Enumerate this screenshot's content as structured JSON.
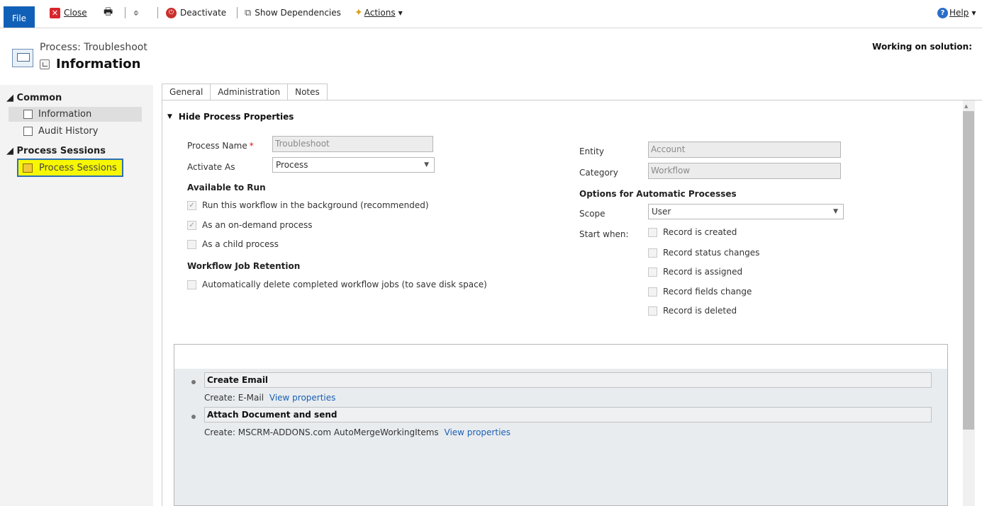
{
  "ribbon": {
    "file_label": "File",
    "close_label": "Close",
    "deactivate_label": "Deactivate",
    "show_dependencies_label": "Show Dependencies",
    "actions_label": "Actions",
    "help_label": "Help"
  },
  "header": {
    "subtitle": "Process: Troubleshoot",
    "title": "Information",
    "solution": "Working on solution:"
  },
  "nav": {
    "common_header": "Common",
    "items": [
      {
        "label": "Information",
        "icon": "process-icon"
      },
      {
        "label": "Audit History",
        "icon": "audit-icon"
      }
    ],
    "sessions_header": "Process Sessions",
    "sessions_item": "Process Sessions"
  },
  "tabs": [
    "General",
    "Administration",
    "Notes"
  ],
  "form": {
    "section_title": "Hide Process Properties",
    "process_name_label": "Process Name",
    "process_name_value": "Troubleshoot",
    "activate_as_label": "Activate As",
    "activate_as_value": "Process",
    "available_to_run": "Available to Run",
    "run_background": "Run this workflow in the background (recommended)",
    "on_demand": "As an on-demand process",
    "child_process": "As a child process",
    "job_retention": "Workflow Job Retention",
    "auto_delete": "Automatically delete completed workflow jobs (to save disk space)",
    "entity_label": "Entity",
    "entity_value": "Account",
    "category_label": "Category",
    "category_value": "Workflow",
    "options_header": "Options for Automatic Processes",
    "scope_label": "Scope",
    "scope_value": "User",
    "start_when_label": "Start when:",
    "start_options": [
      "Record is created",
      "Record status changes",
      "Record is assigned",
      "Record fields change",
      "Record is deleted"
    ]
  },
  "steps": [
    {
      "title": "Create Email",
      "create_label": "Create:",
      "entity": "E-Mail",
      "link": "View properties"
    },
    {
      "title": "Attach Document and send",
      "create_label": "Create:",
      "entity": "MSCRM-ADDONS.com AutoMergeWorkingItems",
      "link": "View properties"
    }
  ],
  "colors": {
    "file_button": "#1160b7",
    "highlight": "#f7f702",
    "link": "#1a5fb4",
    "required": "#d11111"
  }
}
